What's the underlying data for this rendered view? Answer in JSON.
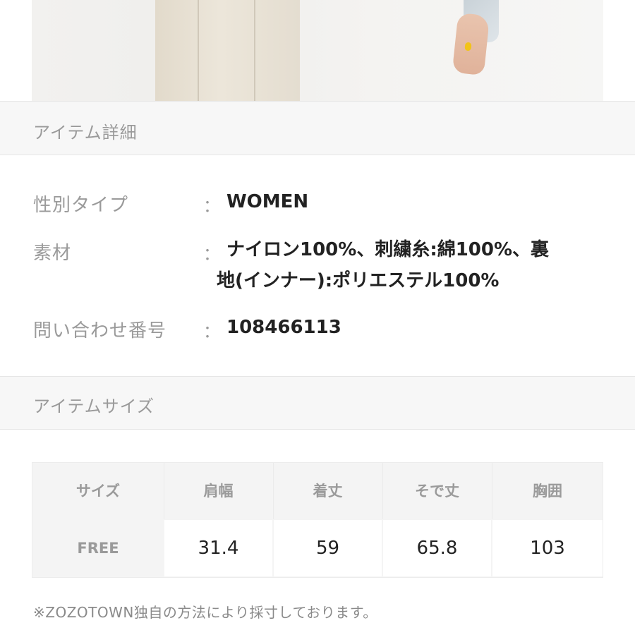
{
  "product_photo": {
    "alt": "product-photo",
    "nail_color": "#f2c318"
  },
  "item_detail": {
    "header": "アイテム詳細",
    "rows": [
      {
        "label": "性別タイプ",
        "colon": "：",
        "value": "WOMEN"
      },
      {
        "label": "素材",
        "colon": "：",
        "value_line1": "ナイロン100%、刺繍糸:綿100%、裏",
        "value_line2": "地(インナー):ポリエステル100%"
      },
      {
        "label": "問い合わせ番号",
        "colon": "：",
        "value": "108466113"
      }
    ]
  },
  "item_size": {
    "header": "アイテムサイズ",
    "columns": [
      "サイズ",
      "肩幅",
      "着丈",
      "そで丈",
      "胸囲"
    ],
    "rows": [
      {
        "size": "FREE",
        "values": [
          "31.4",
          "59",
          "65.8",
          "103"
        ]
      }
    ],
    "note": "※ZOZOTOWN独自の方法により採寸しております。"
  },
  "colors": {
    "header_bg": "#f7f7f7",
    "label_gray": "#9a9a9a",
    "value_text": "#222222",
    "table_bg": "#f4f4f4"
  }
}
